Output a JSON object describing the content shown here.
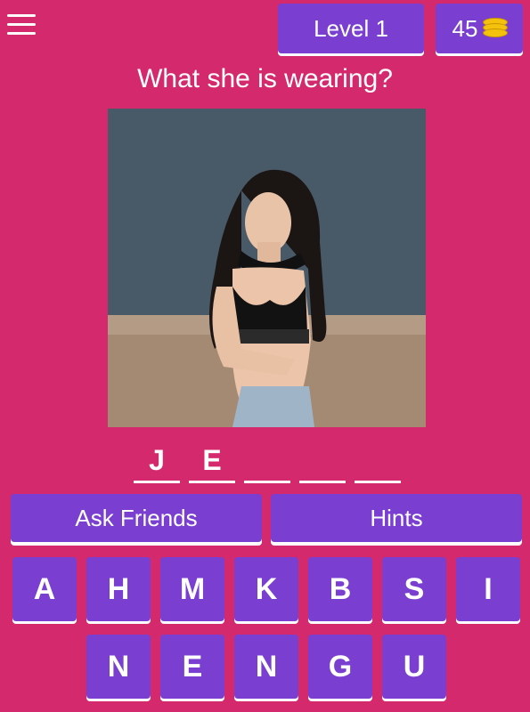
{
  "header": {
    "menu_icon": "hamburger-menu-icon",
    "level_label": "Level 1",
    "coins": "45",
    "coin_icon": "coin-stack-icon"
  },
  "question": "What she is wearing?",
  "image": {
    "description_icon": "photo"
  },
  "answer": {
    "slots": [
      "J",
      "E",
      "",
      "",
      ""
    ]
  },
  "actions": {
    "ask_friends_label": "Ask Friends",
    "hints_label": "Hints"
  },
  "keyboard": {
    "row1": [
      "A",
      "H",
      "M",
      "K",
      "B",
      "S",
      "I"
    ],
    "row2": [
      "N",
      "E",
      "N",
      "G",
      "U"
    ]
  },
  "colors": {
    "background": "#D42A6D",
    "button": "#7A3FD0",
    "text": "#FFFFFF",
    "coin": "#F4C20D"
  }
}
